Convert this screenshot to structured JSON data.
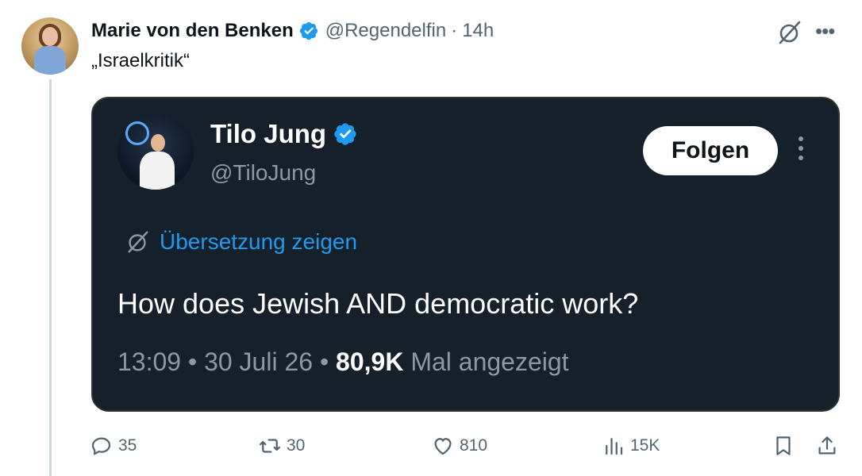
{
  "post": {
    "author_name": "Marie von den Benken",
    "handle": "@Regendelfin",
    "separator": "·",
    "time": "14h",
    "text": "„Israelkritik“"
  },
  "quoted_post": {
    "author_name": "Tilo Jung",
    "handle": "@TiloJung",
    "follow_label": "Folgen",
    "translate_label": "Übersetzung zeigen",
    "text": "How does Jewish AND democratic work?",
    "time": "13:09",
    "date": "30 Juli 26",
    "views_count": "80,9K",
    "views_label": "Mal angezeigt"
  },
  "actions": {
    "replies": "35",
    "reposts": "30",
    "likes": "810",
    "views": "15K"
  },
  "colors": {
    "accent": "#1d9bf0",
    "verified": "#1d9bf0",
    "quote_bg": "#15202b",
    "muted": "#536471"
  },
  "icons": [
    "translate-icon",
    "more-icon",
    "verified-badge-icon",
    "reply-icon",
    "repost-icon",
    "like-icon",
    "views-icon",
    "bookmark-icon",
    "share-icon"
  ]
}
